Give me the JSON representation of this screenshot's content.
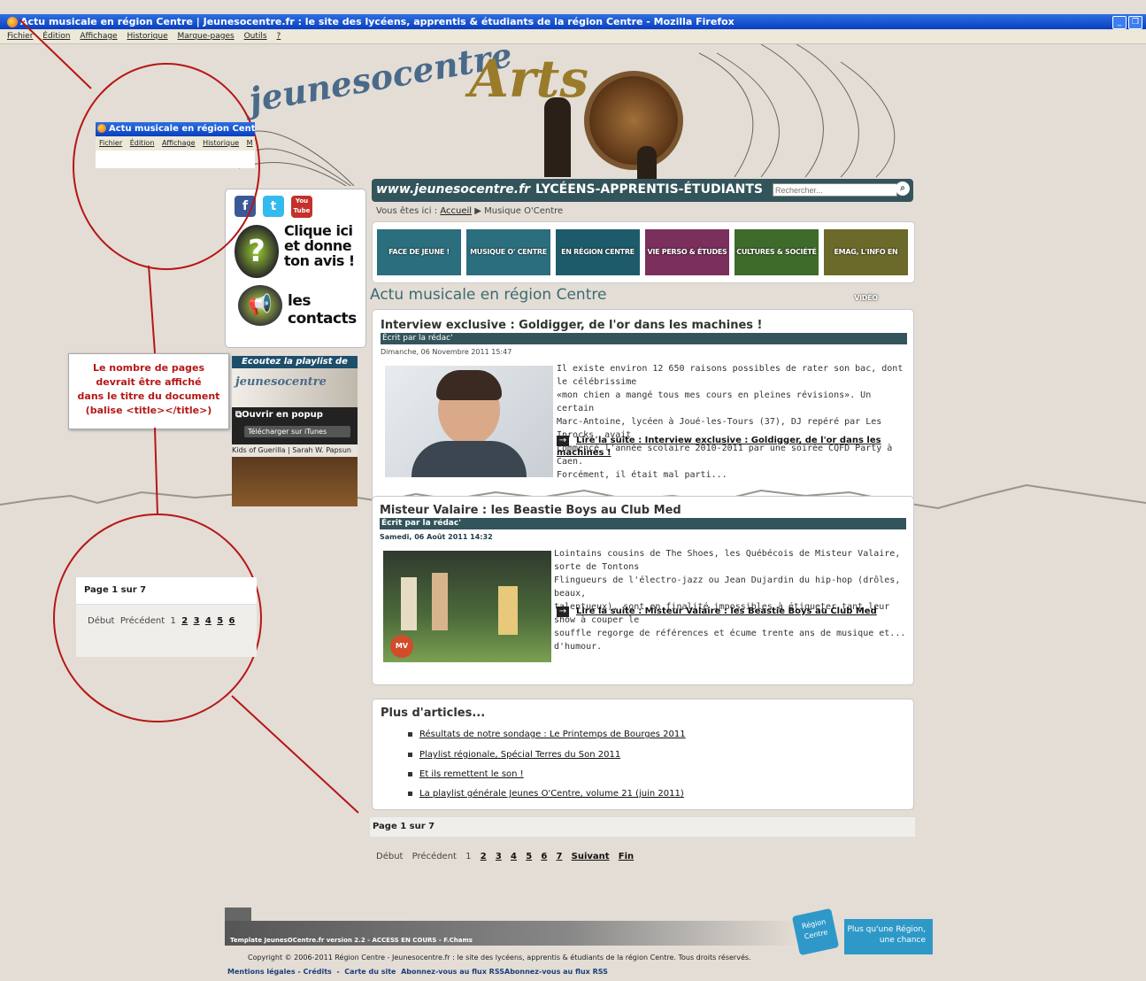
{
  "window": {
    "title": "Actu musicale en région Centre | Jeunesocentre.fr : le site des lycéens, apprentis & étudiants de la région Centre - Mozilla Firefox",
    "menu": [
      "Fichier",
      "Édition",
      "Affichage",
      "Historique",
      "Marque-pages",
      "Outils",
      "?"
    ]
  },
  "header": {
    "logo": "jeunesocentre",
    "banner": "Arts",
    "url": "www.jeunesocentre.fr",
    "tagline": "LYCÉENS-APPRENTIS-ÉTUDIANTS",
    "search_placeholder": "Rechercher..."
  },
  "breadcrumb": {
    "prefix": "Vous êtes ici :",
    "home": "Accueil",
    "current": "Musique O'Centre"
  },
  "categories": [
    {
      "label": "FACE DE JEUNE !",
      "color": "#2b6e7e"
    },
    {
      "label": "MUSIQUE O' CENTRE",
      "color": "#2b6e7e"
    },
    {
      "label": "EN RÉGION CENTRE",
      "color": "#1d5b6b"
    },
    {
      "label": "VIE PERSO & ÉTUDES",
      "color": "#7a2f5c"
    },
    {
      "label": "CULTURES & SOCIÉTÉ",
      "color": "#3e6a2a"
    },
    {
      "label": "EMAG, L'INFO EN VIDÉO",
      "color": "#6b6a2a"
    }
  ],
  "section_title": "Actu musicale en région Centre",
  "articles": [
    {
      "title": "Interview exclusive : Goldigger, de l'or dans les machines !",
      "author": "Écrit par la rédac'",
      "date": "Dimanche, 06 Novembre 2011 15:47",
      "body": [
        "Il existe environ 12 650 raisons possibles de rater son bac, dont le célébrissime",
        "«mon chien a mangé tous mes cours en pleines révisions». Un certain",
        "Marc-Antoine, lycéen à Joué-les-Tours (37), DJ repéré par Les Inrocks, avait",
        "commencé l'année scolaire 2010-2011 par une soirée CQFD Party à Caen.",
        "Forcément, il était mal parti..."
      ],
      "more": "Lire la suite : Interview exclusive : Goldigger, de l'or dans les machines !"
    },
    {
      "title": "Misteur Valaire : les Beastie Boys au Club Med",
      "author": "Écrit par la rédac'",
      "date": "Samedi, 06 Août 2011 14:32",
      "body": [
        "Lointains cousins de The Shoes, les Québécois de Misteur Valaire, sorte de Tontons",
        "Flingueurs de l'électro-jazz ou Jean Dujardin du hip-hop (drôles, beaux,",
        "talentueux), sont en finalité impossibles à étiqueter tant leur show à couper le",
        "souffle regorge de références et écume trente ans de musique et... d'humour."
      ],
      "more": "Lire la suite : Misteur Valaire : les Beastie Boys au Club Med"
    }
  ],
  "more_articles": {
    "title": "Plus d'articles...",
    "items": [
      "Résultats de notre sondage : Le Printemps de Bourges 2011",
      "Playlist régionale, Spécial Terres du Son 2011",
      "Et ils remettent le son !",
      "La playlist générale Jeunes O'Centre, volume 21 (juin 2011)"
    ]
  },
  "pagination": {
    "label": "Page 1 sur 7",
    "start": "Début",
    "prev": "Précédent",
    "current": "1",
    "pages": [
      "2",
      "3",
      "4",
      "5",
      "6",
      "7"
    ],
    "next": "Suivant",
    "end": "Fin"
  },
  "sidebar": {
    "social": [
      "f",
      "t",
      "You Tube"
    ],
    "feedback": "Clique ici et donne ton avis !",
    "contacts": "les contacts",
    "playlist_title": "Ecoutez la playlist de",
    "playlist_brand": "jeunesocentre",
    "popup": "Ouvrir en popup",
    "itunes": "Télécharger sur iTunes",
    "track": "Kids of Guerilla | Sarah W. Papsun"
  },
  "zoom_title": {
    "title": "Actu musicale en région Centre",
    "menu": [
      "Fichier",
      "Édition",
      "Affichage",
      "Historique",
      "M"
    ]
  },
  "zoom_pager": {
    "label": "Page 1 sur 7",
    "start": "Début",
    "prev": "Précédent",
    "current": "1",
    "pages": [
      "2",
      "3",
      "4",
      "5",
      "6"
    ]
  },
  "annotation": [
    "Le nombre de pages",
    "devrait être affiché",
    "dans le titre du document",
    "(balise <title></title>)"
  ],
  "footer": {
    "template": "Template JeunesOCentre.fr version 2.2 - ACCESS EN COURS - F.Chams",
    "region": "Région Centre",
    "slogan": [
      "Plus qu'une Région,",
      "une chance"
    ],
    "copyright": "Copyright © 2006-2011 Région Centre - Jeunesocentre.fr : le site des lycéens, apprentis & étudiants de la région Centre. Tous droits réservés.",
    "links": [
      "Mentions légales",
      "Crédits",
      "Carte du site",
      "Abonnez-vous au flux RSS",
      "Abonnez-vous au flux RSS"
    ]
  }
}
